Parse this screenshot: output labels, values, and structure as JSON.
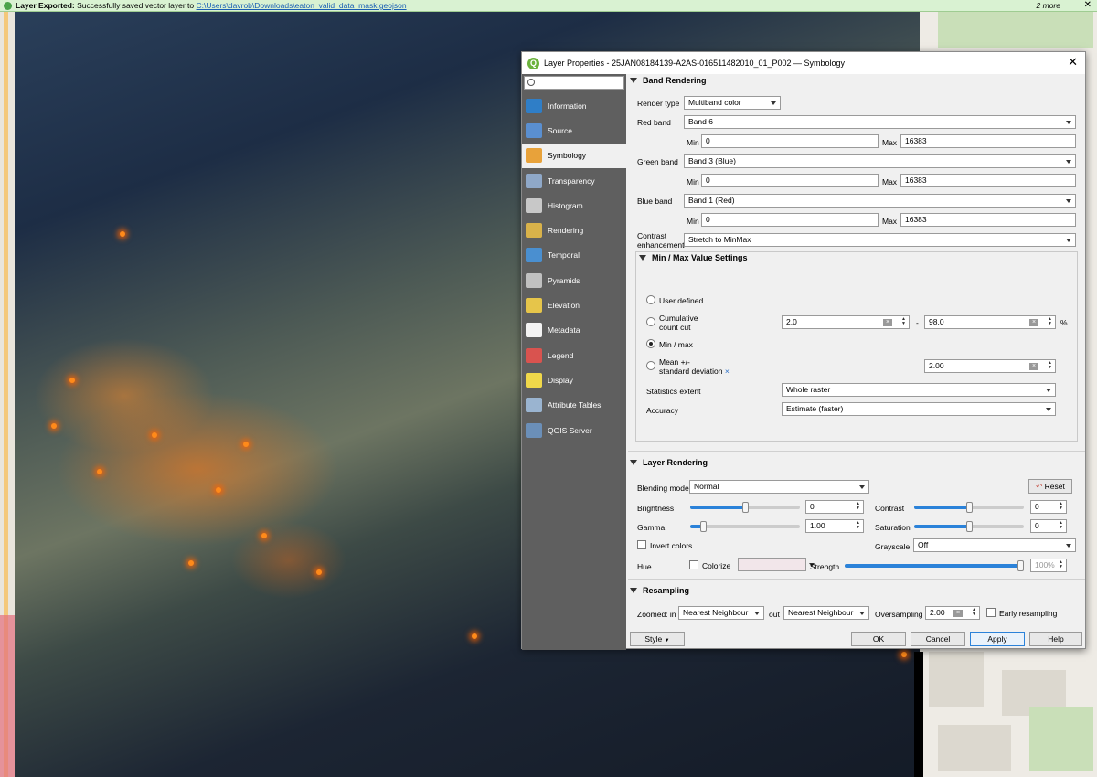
{
  "message_bar": {
    "title": "Layer Exported:",
    "text": "Successfully saved vector layer to",
    "link": "C:\\Users\\davrob\\Downloads\\eaton_valid_data_mask.geojson",
    "more": "2 more",
    "close": "✕"
  },
  "dialog": {
    "title": "Layer Properties - 25JAN08184139-A2AS-016511482010_01_P002 — Symbology",
    "close": "✕"
  },
  "sidebar": {
    "items": [
      {
        "label": "Information",
        "color": "#2f7ec7"
      },
      {
        "label": "Source",
        "color": "#5a8fd0"
      },
      {
        "label": "Symbology",
        "color": "#e8a23a"
      },
      {
        "label": "Transparency",
        "color": "#8fa8c8"
      },
      {
        "label": "Histogram",
        "color": "#c8c8c8"
      },
      {
        "label": "Rendering",
        "color": "#d9b24a"
      },
      {
        "label": "Temporal",
        "color": "#4a8fd0"
      },
      {
        "label": "Pyramids",
        "color": "#c0c0c0"
      },
      {
        "label": "Elevation",
        "color": "#e6c54a"
      },
      {
        "label": "Metadata",
        "color": "#f3f3f3"
      },
      {
        "label": "Legend",
        "color": "#d9534f"
      },
      {
        "label": "Display",
        "color": "#f0d84a"
      },
      {
        "label": "Attribute Tables",
        "color": "#9ab4d0"
      },
      {
        "label": "QGIS Server",
        "color": "#6b8fb8"
      }
    ]
  },
  "band_rendering": {
    "header": "Band Rendering",
    "render_type_label": "Render type",
    "render_type": "Multiband color",
    "red_label": "Red band",
    "red_band": "Band 6",
    "green_label": "Green band",
    "green_band": "Band 3 (Blue)",
    "blue_label": "Blue band",
    "blue_band": "Band 1 (Red)",
    "min_label": "Min",
    "max_label": "Max",
    "min_value": "0",
    "max_value": "16383",
    "contrast_label_1": "Contrast",
    "contrast_label_2": "enhancement",
    "contrast": "Stretch to MinMax"
  },
  "minmax": {
    "header": "Min / Max Value Settings",
    "user_defined": "User defined",
    "cumulative_1": "Cumulative",
    "cumulative_2": "count cut",
    "cum_low": "2.0",
    "cum_high": "98.0",
    "dash": "-",
    "percent": "%",
    "min_max": "Min / max",
    "mean_1": "Mean +/-",
    "mean_2": "standard deviation",
    "mean_x": "×",
    "std_value": "2.00",
    "stat_extent_label": "Statistics extent",
    "stat_extent": "Whole raster",
    "accuracy_label": "Accuracy",
    "accuracy": "Estimate (faster)"
  },
  "layer_rendering": {
    "header": "Layer Rendering",
    "blending_label": "Blending mode",
    "blending": "Normal",
    "reset": "Reset",
    "brightness_label": "Brightness",
    "brightness": "0",
    "brightness_level": 0.5,
    "contrast_label": "Contrast",
    "contrast": "0",
    "contrast_level": 0.5,
    "gamma_label": "Gamma",
    "gamma": "1.00",
    "gamma_level": 0.1,
    "saturation_label": "Saturation",
    "saturation": "0",
    "saturation_level": 0.5,
    "invert_label": "Invert colors",
    "grayscale_label": "Grayscale",
    "grayscale": "Off",
    "hue_label": "Hue",
    "colorize_label": "Colorize",
    "strength_label": "Strength",
    "strength": "100%",
    "strength_level": 1.0
  },
  "resampling": {
    "header": "Resampling",
    "zoomed_in_label": "Zoomed: in",
    "zoomed_in": "Nearest Neighbour",
    "out_label": "out",
    "zoomed_out": "Nearest Neighbour",
    "oversampling_label": "Oversampling",
    "oversampling": "2.00",
    "early_label": "Early resampling"
  },
  "buttons": {
    "style": "Style",
    "ok": "OK",
    "cancel": "Cancel",
    "apply": "Apply",
    "help": "Help"
  }
}
